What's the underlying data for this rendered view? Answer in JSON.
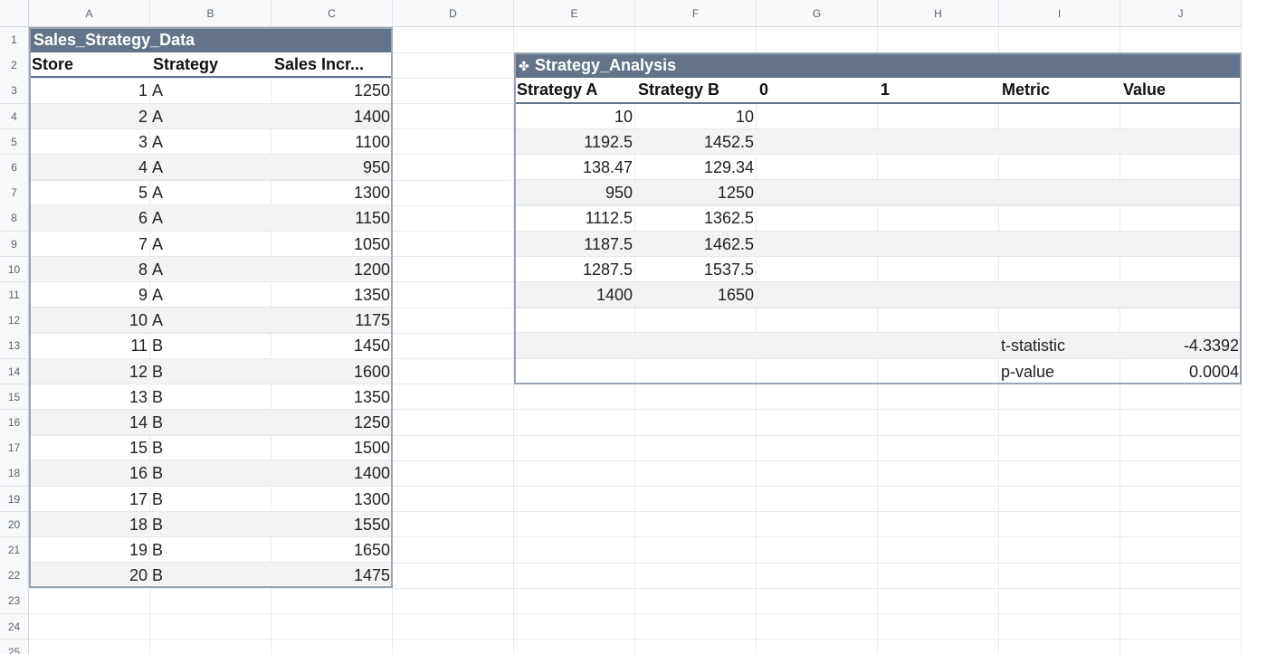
{
  "columns": [
    "A",
    "B",
    "C",
    "D",
    "E",
    "F",
    "G",
    "H",
    "I",
    "J"
  ],
  "rows": [
    "1",
    "2",
    "3",
    "4",
    "5",
    "6",
    "7",
    "8",
    "9",
    "10",
    "11",
    "12",
    "13",
    "14",
    "15",
    "16",
    "17",
    "18",
    "19",
    "20",
    "21",
    "22",
    "23",
    "24",
    "25"
  ],
  "sales_table": {
    "title": "Sales_Strategy_Data",
    "headers": [
      "Store",
      "Strategy",
      "Sales Incr..."
    ],
    "rows": [
      [
        "1",
        "A",
        "1250"
      ],
      [
        "2",
        "A",
        "1400"
      ],
      [
        "3",
        "A",
        "1100"
      ],
      [
        "4",
        "A",
        "950"
      ],
      [
        "5",
        "A",
        "1300"
      ],
      [
        "6",
        "A",
        "1150"
      ],
      [
        "7",
        "A",
        "1050"
      ],
      [
        "8",
        "A",
        "1200"
      ],
      [
        "9",
        "A",
        "1350"
      ],
      [
        "10",
        "A",
        "1175"
      ],
      [
        "11",
        "B",
        "1450"
      ],
      [
        "12",
        "B",
        "1600"
      ],
      [
        "13",
        "B",
        "1350"
      ],
      [
        "14",
        "B",
        "1250"
      ],
      [
        "15",
        "B",
        "1500"
      ],
      [
        "16",
        "B",
        "1400"
      ],
      [
        "17",
        "B",
        "1300"
      ],
      [
        "18",
        "B",
        "1550"
      ],
      [
        "19",
        "B",
        "1650"
      ],
      [
        "20",
        "B",
        "1475"
      ]
    ]
  },
  "analysis_table": {
    "icon": "python-icon",
    "icon_glyph": "✤",
    "title": "Strategy_Analysis",
    "headers": [
      "Strategy A",
      "Strategy B",
      "0",
      "1",
      "Metric",
      "Value"
    ],
    "rows": [
      [
        "10",
        "10",
        "",
        "",
        "",
        ""
      ],
      [
        "1192.5",
        "1452.5",
        "",
        "",
        "",
        ""
      ],
      [
        "138.47",
        "129.34",
        "",
        "",
        "",
        ""
      ],
      [
        "950",
        "1250",
        "",
        "",
        "",
        ""
      ],
      [
        "1112.5",
        "1362.5",
        "",
        "",
        "",
        ""
      ],
      [
        "1187.5",
        "1462.5",
        "",
        "",
        "",
        ""
      ],
      [
        "1287.5",
        "1537.5",
        "",
        "",
        "",
        ""
      ],
      [
        "1400",
        "1650",
        "",
        "",
        "",
        ""
      ],
      [
        "",
        "",
        "",
        "",
        "",
        ""
      ],
      [
        "",
        "",
        "",
        "",
        "t-statistic",
        "-4.3392"
      ],
      [
        "",
        "",
        "",
        "",
        "p-value",
        "0.0004"
      ]
    ]
  },
  "colors": {
    "table_title_bg": "#63748a",
    "table_border": "#9aa5b4",
    "band_row": "#f3f3f3",
    "header_bg": "#f8f9fa"
  }
}
